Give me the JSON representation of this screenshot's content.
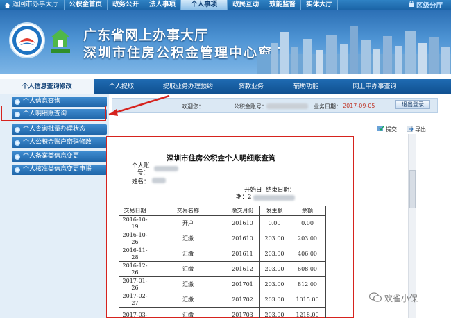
{
  "topnav": {
    "items": [
      "返回市办事大厅",
      "公积金首页",
      "政务公开",
      "法人事项",
      "个人事项",
      "政民互动",
      "效能监督",
      "实体大厅"
    ],
    "active_index": 4,
    "right_label": "区级分厅"
  },
  "banner": {
    "title_line1": "广东省网上办事大厅",
    "title_line2": "深圳市住房公积金管理中心窗口"
  },
  "subnav": {
    "items": [
      "个人信息查询修改",
      "个人提取",
      "提取业务办理预约",
      "贷款业务",
      "辅助功能",
      "网上申办事查询"
    ],
    "active_index": 0
  },
  "sidebar": {
    "items": [
      "个人信息查询",
      "个人明细账查询",
      "个人查询批量办理状态",
      "个人公积金账户密码修改",
      "个人备案类信息变更",
      "个人核准类信息变更申报"
    ],
    "selected_index": 1
  },
  "infobar": {
    "welcome_label": "欢迎您：",
    "account_label": "公积金账号：",
    "date_label": "业务日期：",
    "date_value": "2017-09-05",
    "exit_label": "退出登录"
  },
  "toolbar": {
    "submit_label": "提交",
    "export_label": "导出"
  },
  "report": {
    "title": "深圳市住房公积金个人明细账查询",
    "account_label_line1": "个人账",
    "account_label_line2": "号：",
    "name_label": "姓名：",
    "start_label_line1": "开始日",
    "start_label_line2": "期：",
    "end_label": "结束日期：",
    "end_digit": "2",
    "columns": [
      "交易日期",
      "交易名称",
      "缴交月份",
      "发生额",
      "余额"
    ],
    "rows": [
      {
        "date_l1": "2016-10-",
        "date_l2": "19",
        "name": "开户",
        "month": "201610",
        "amount": "0.00",
        "balance": "0.00"
      },
      {
        "date_l1": "2016-10-",
        "date_l2": "26",
        "name": "汇缴",
        "month": "201610",
        "amount": "203.00",
        "balance": "203.00"
      },
      {
        "date_l1": "2016-11-",
        "date_l2": "28",
        "name": "汇缴",
        "month": "201611",
        "amount": "203.00",
        "balance": "406.00"
      },
      {
        "date_l1": "2016-12-",
        "date_l2": "26",
        "name": "汇缴",
        "month": "201612",
        "amount": "203.00",
        "balance": "608.00"
      },
      {
        "date_l1": "2017-01-",
        "date_l2": "26",
        "name": "汇缴",
        "month": "201701",
        "amount": "203.00",
        "balance": "812.00"
      },
      {
        "date_l1": "2017-02-",
        "date_l2": "27",
        "name": "汇缴",
        "month": "201702",
        "amount": "203.00",
        "balance": "1015.00"
      },
      {
        "date_l1": "2017-03-",
        "date_l2": "",
        "name": "汇缴",
        "month": "201703",
        "amount": "203.00",
        "balance": "1218.00"
      }
    ]
  },
  "watermark": "欢雀小保",
  "colors": {
    "accent": "#1b64a6",
    "highlight": "#d6231e",
    "date": "#c0392b"
  }
}
